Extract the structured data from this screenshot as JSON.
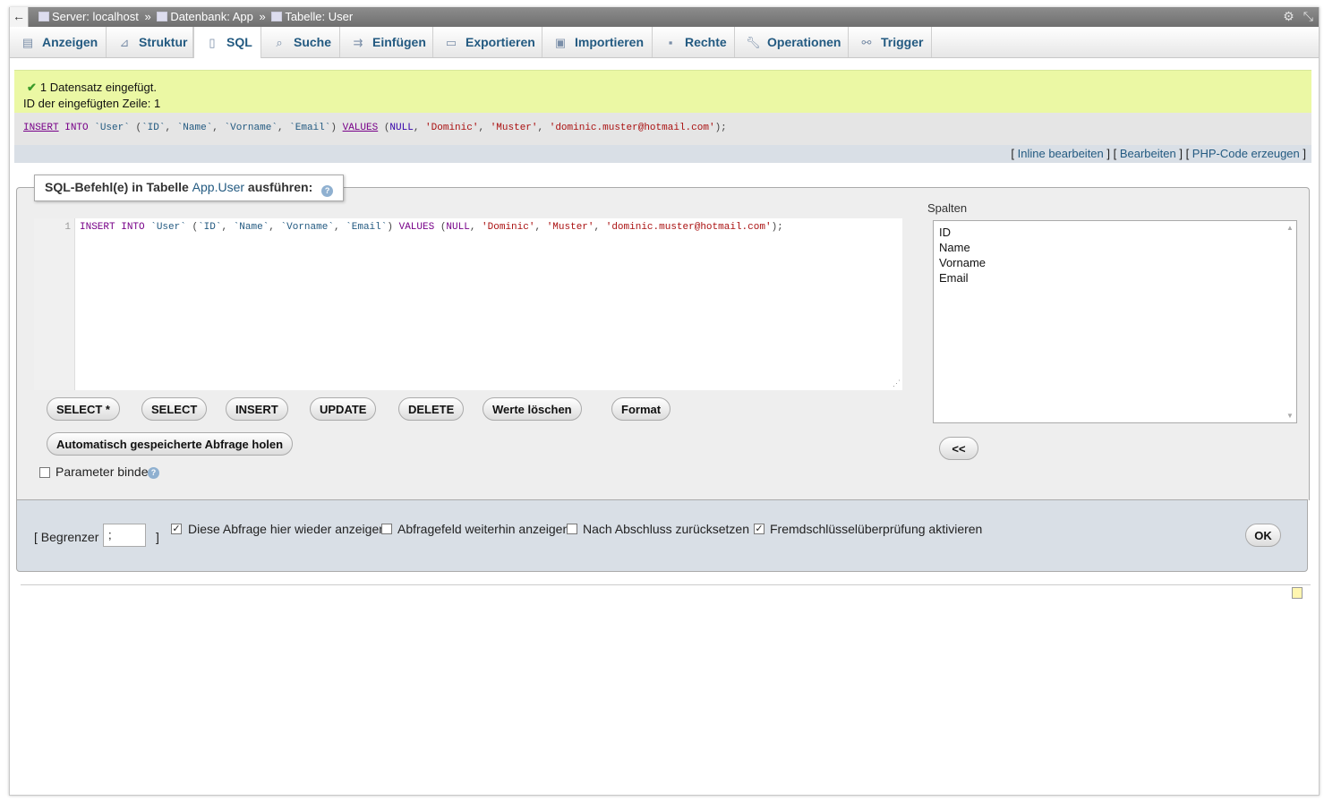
{
  "breadcrumb": {
    "server": "Server: localhost",
    "database": "Datenbank: App",
    "table": "Tabelle: User",
    "separator": "»"
  },
  "tabs": [
    {
      "label": "Anzeigen",
      "icon": "table-browse-icon"
    },
    {
      "label": "Struktur",
      "icon": "structure-icon"
    },
    {
      "label": "SQL",
      "icon": "sql-icon"
    },
    {
      "label": "Suche",
      "icon": "search-icon"
    },
    {
      "label": "Einfügen",
      "icon": "insert-icon"
    },
    {
      "label": "Exportieren",
      "icon": "export-icon"
    },
    {
      "label": "Importieren",
      "icon": "import-icon"
    },
    {
      "label": "Rechte",
      "icon": "privileges-icon"
    },
    {
      "label": "Operationen",
      "icon": "wrench-icon"
    },
    {
      "label": "Trigger",
      "icon": "trigger-icon"
    }
  ],
  "active_tab": "SQL",
  "message": {
    "line1": "1 Datensatz eingefügt.",
    "line2": "ID der eingefügten Zeile: 1"
  },
  "executed_query": "INSERT INTO `User` (`ID`, `Name`, `Vorname`, `Email`) VALUES (NULL, 'Dominic', 'Muster', 'dominic.muster@hotmail.com');",
  "query_actions": [
    "Inline bearbeiten",
    "Bearbeiten",
    "PHP-Code erzeugen"
  ],
  "sql_form": {
    "legend_prefix": "SQL-Befehl(e) in Tabelle",
    "legend_link": "App.User",
    "legend_suffix": "ausführen:",
    "line_number": "1",
    "editor_content": "INSERT INTO `User` (`ID`, `Name`, `Vorname`, `Email`) VALUES (NULL, 'Dominic', 'Muster', 'dominic.muster@hotmail.com');",
    "buttons": [
      "SELECT *",
      "SELECT",
      "INSERT",
      "UPDATE",
      "DELETE",
      "Werte löschen",
      "Format"
    ],
    "restore_button": "Automatisch gespeicherte Abfrage holen",
    "bind_params_label": "Parameter binden",
    "columns_label": "Spalten",
    "columns": [
      "ID",
      "Name",
      "Vorname",
      "Email"
    ],
    "insert_column_button": "<<"
  },
  "options": {
    "delimiter_label": "[ Begrenzer",
    "delimiter_close": "]",
    "delimiter_value": ";",
    "checkboxes": [
      {
        "label": "Diese Abfrage hier wieder anzeigen",
        "checked": true
      },
      {
        "label": "Abfragefeld weiterhin anzeigen",
        "checked": false
      },
      {
        "label": "Nach Abschluss zurücksetzen",
        "checked": false
      },
      {
        "label": "Fremdschlüsselüberprüfung aktivieren",
        "checked": true
      }
    ],
    "ok_button": "OK"
  },
  "colors": {
    "success_bg": "#ebf8a4",
    "link": "#235a81",
    "keyword": "#770088",
    "string": "#aa1111"
  }
}
